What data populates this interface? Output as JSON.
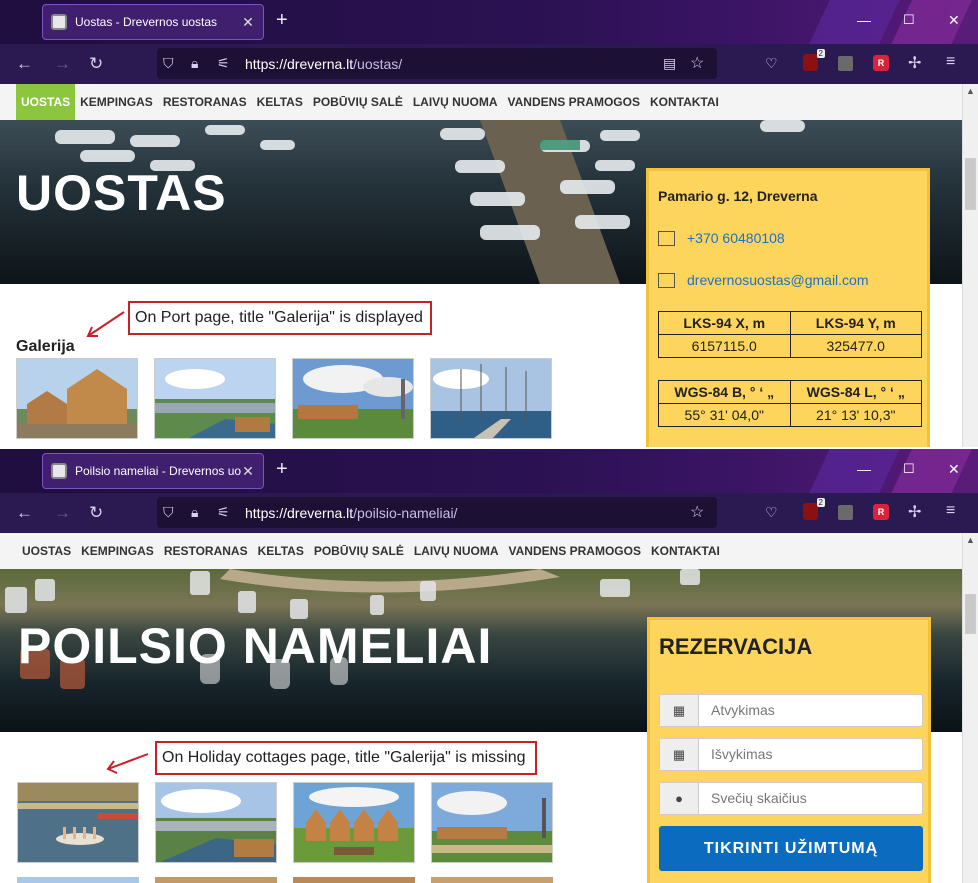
{
  "shot1": {
    "tab": {
      "title": "Uostas - Drevernos uostas"
    },
    "url": {
      "host": "https://dreverna.lt",
      "path": "/uostas/"
    },
    "ext_badge": "2",
    "menu": [
      "UOSTAS",
      "KEMPINGAS",
      "RESTORANAS",
      "KELTAS",
      "POBŪVIŲ SALĖ",
      "LAIVŲ NUOMA",
      "VANDENS PRAMOGOS",
      "KONTAKTAI"
    ],
    "active_menu": "UOSTAS",
    "hero_title": "UOSTAS",
    "contact": {
      "address": "Pamario g. 12, Dreverna",
      "phone": "+370 60480108",
      "email": "drevernosuostas@gmail.com",
      "lks": {
        "h1": "LKS-94 X, m",
        "h2": "LKS-94 Y, m",
        "v1": "6157115.0",
        "v2": "325477.0"
      },
      "wgs": {
        "h1": "WGS-84 B, ° ʻ „",
        "h2": "WGS-84 L, ° ʻ „",
        "v1": "55° 31' 04,0\"",
        "v2": "21° 13' 10,3\""
      }
    },
    "gallery_title": "Galerija",
    "annotation": "On Port page, title \"Galerija\" is displayed"
  },
  "shot2": {
    "tab": {
      "title": "Poilsio nameliai - Drevernos uos"
    },
    "url": {
      "host": "https://dreverna.lt",
      "path": "/poilsio-nameliai/"
    },
    "ext_badge": "2",
    "menu": [
      "UOSTAS",
      "KEMPINGAS",
      "RESTORANAS",
      "KELTAS",
      "POBŪVIŲ SALĖ",
      "LAIVŲ NUOMA",
      "VANDENS PRAMOGOS",
      "KONTAKTAI"
    ],
    "hero_title": "POILSIO NAMELIAI",
    "reservation": {
      "title": "REZERVACIJA",
      "checkin_placeholder": "Atvykimas",
      "checkout_placeholder": "Išvykimas",
      "guests_placeholder": "Svečių skaičius",
      "button": "TIKRINTI UŽIMTUMĄ"
    },
    "annotation": "On Holiday cottages page, title \"Galerija\" is missing"
  },
  "icons": {
    "back": "arrow-left",
    "forward": "arrow-right",
    "reload": "reload",
    "shield": "shield",
    "lock": "lock",
    "permissions": "tune",
    "reader": "reader-view",
    "bookmark": "star",
    "pocket": "pocket",
    "ublock": "ublock-origin",
    "menu": "hamburger",
    "calendar": "calendar",
    "user": "user"
  },
  "colors": {
    "active_menu": "#8cc63f",
    "sidebox": "#fdd55c",
    "button": "#0a6bbf",
    "annotation": "#c8202a",
    "link": "#1a73c4"
  }
}
